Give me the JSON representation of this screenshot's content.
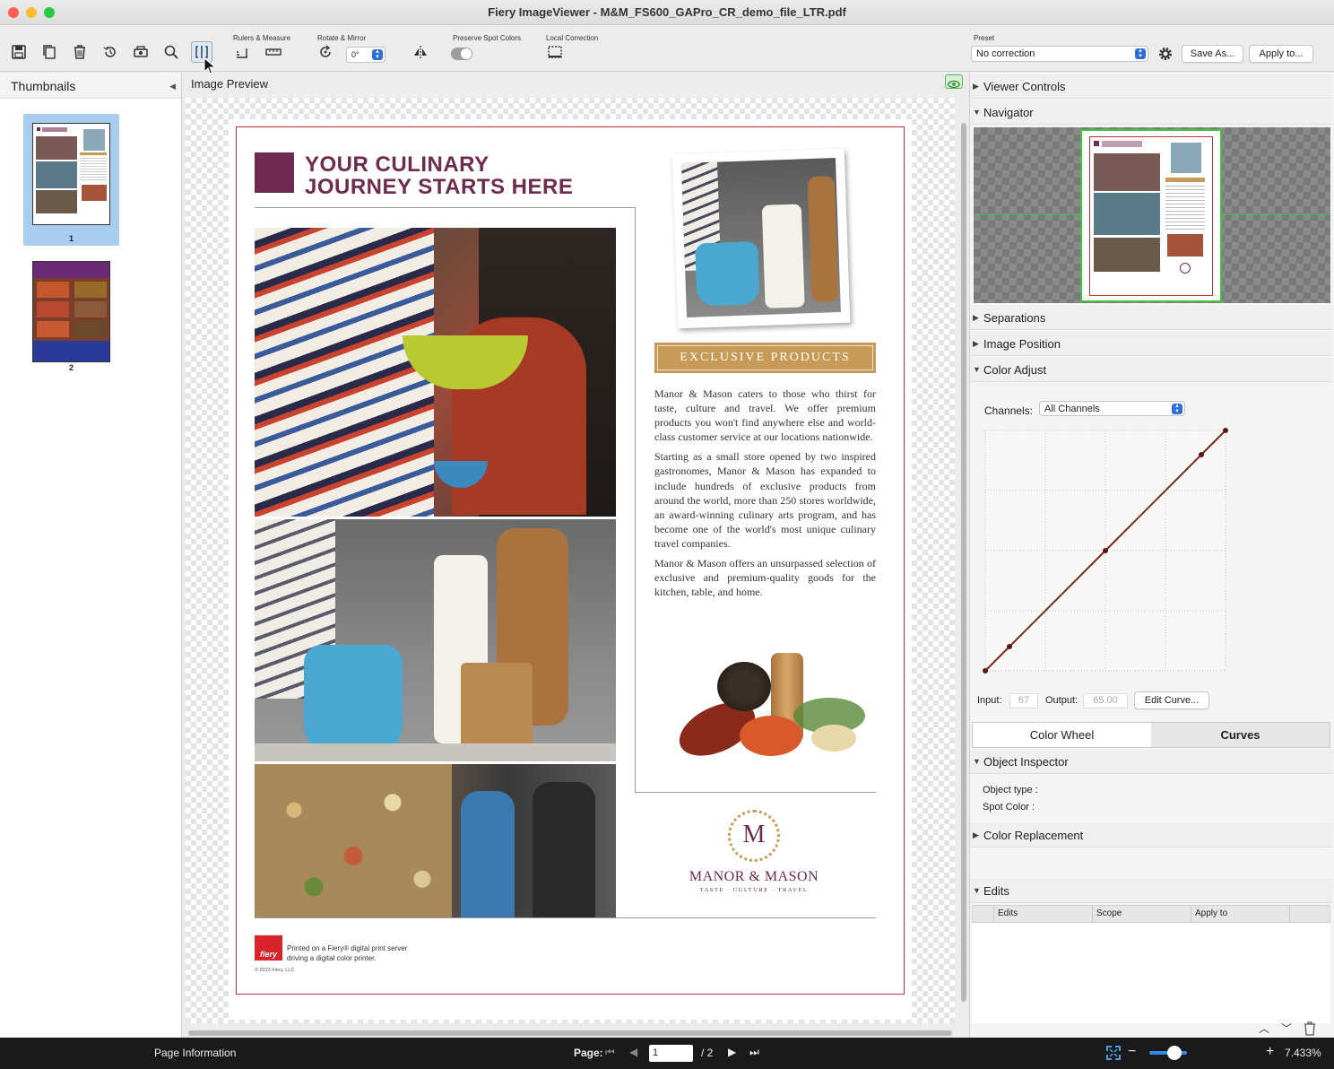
{
  "window": {
    "title": "Fiery ImageViewer - M&M_FS600_GAPro_CR_demo_file_LTR.pdf"
  },
  "toolbar": {
    "group_rulers": "Rulers & Measure",
    "group_rotate": "Rotate & Mirror",
    "rotate_value": "0°",
    "group_spot": "Preserve Spot Colors",
    "group_local": "Local Correction",
    "preset_label": "Preset",
    "preset_value": "No correction",
    "save_as": "Save As...",
    "apply_to": "Apply to..."
  },
  "thumbnails": {
    "title": "Thumbnails",
    "pages": [
      {
        "label": "1"
      },
      {
        "label": "2"
      }
    ]
  },
  "preview": {
    "title": "Image Preview"
  },
  "document": {
    "headline_1": "YOUR CULINARY",
    "headline_2": "JOURNEY STARTS HERE",
    "banner": "EXCLUSIVE PRODUCTS",
    "para_1": "Manor & Mason caters to those who thirst for taste, culture and travel. We offer premium products you won't find anywhere else and world-class customer service at our locations nationwide.",
    "para_2": "Starting as a small store opened by two inspired gastronomes, Manor & Mason has expanded to include hundreds of exclusive products from around the world, more than 250 stores worldwide, an award-winning culinary arts program, and has become one of the world's most unique culinary travel companies.",
    "para_3": "Manor & Mason offers an unsurpassed selection of exclusive and premium-quality goods for the kitchen, table, and home.",
    "logo_letter": "M",
    "logo_name": "MANOR & MASON",
    "logo_tagline": "TASTE · CULTURE · TRAVEL",
    "fiery_badge": "fiery",
    "printed_1": "Printed on a Fiery® digital print server",
    "printed_2": "driving a digital color printer.",
    "copyright": "© 2023 Fiery, LLC"
  },
  "panels": {
    "viewer_controls": "Viewer Controls",
    "navigator": "Navigator",
    "separations": "Separations",
    "image_position": "Image Position",
    "color_adjust": "Color Adjust",
    "object_inspector": "Object Inspector",
    "color_replacement": "Color Replacement",
    "edits": "Edits"
  },
  "color_adjust": {
    "channels_label": "Channels:",
    "channels_value": "All Channels",
    "input_label": "Input:",
    "input_value": "67",
    "output_label": "Output:",
    "output_value": "65.00",
    "edit_curve": "Edit Curve...",
    "tab_wheel": "Color Wheel",
    "tab_curves": "Curves"
  },
  "object_inspector": {
    "object_type": "Object type :",
    "spot_color": "Spot Color :"
  },
  "edits_table": {
    "columns": [
      "Edits",
      "Scope",
      "Apply to"
    ]
  },
  "statusbar": {
    "page_info": "Page Information",
    "page_label": "Page:",
    "page_value": "1",
    "page_total": "/ 2",
    "zoom": "7.433%"
  },
  "colors": {
    "accent": "#2f6ed8",
    "brand_plum": "#6e2a4f",
    "gold": "#c79a57",
    "trim_red": "#c0303a",
    "curve": "#7a2a1c"
  }
}
